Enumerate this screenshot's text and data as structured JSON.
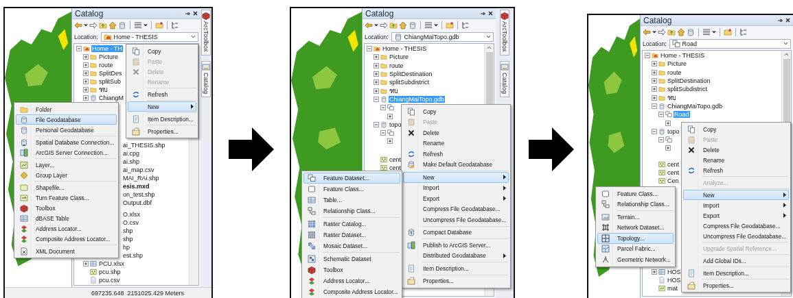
{
  "panels": [
    {
      "catalog": {
        "title": "Catalog",
        "location_label": "Location:",
        "location": {
          "kind": "home",
          "text": "Home - THESIS"
        },
        "tree": [
          {
            "label": "Home - TH",
            "kind": "home",
            "expanded": true,
            "selected": true,
            "children": [
              {
                "label": "Picture",
                "kind": "folder",
                "expanded": false,
                "selected": false
              },
              {
                "label": "route",
                "kind": "folder",
                "expanded": false,
                "selected": false
              },
              {
                "label": "SplitDes",
                "kind": "folder",
                "expanded": false,
                "selected": false
              },
              {
                "label": "splitSub",
                "kind": "folder",
                "expanded": false,
                "selected": false
              },
              {
                "label": "ฑบ",
                "kind": "folder",
                "expanded": false,
                "selected": false
              },
              {
                "label": "ChiangM",
                "kind": "database",
                "expanded": false,
                "selected": false
              },
              {
                "label": "ai_THESIS.shp",
                "kind": "fragment",
                "bold": false,
                "selected": false
              },
              {
                "label": "ai.cpg",
                "kind": "fragment",
                "bold": false,
                "selected": false
              },
              {
                "label": "ai.shp",
                "kind": "fragment",
                "bold": false,
                "selected": false
              },
              {
                "label": "ai_map.csv",
                "kind": "fragment",
                "bold": false,
                "selected": false
              },
              {
                "label": "MAI_RAi.shp",
                "kind": "fragment",
                "bold": false,
                "selected": false
              },
              {
                "label": "esis.mxd",
                "kind": "fragment",
                "bold": true,
                "selected": false
              },
              {
                "label": "on_test.shp",
                "kind": "fragment",
                "bold": false,
                "selected": false
              },
              {
                "label": "Output.dbf",
                "kind": "fragment",
                "bold": false,
                "selected": false
              },
              {
                "label": "O.xlsx",
                "kind": "fragment",
                "bold": false,
                "selected": false
              },
              {
                "label": "O.csv",
                "kind": "fragment",
                "bold": false,
                "selected": false
              },
              {
                "label": "shp",
                "kind": "fragment",
                "bold": false,
                "selected": false
              },
              {
                "label": "shp",
                "kind": "fragment",
                "bold": false,
                "selected": false
              },
              {
                "label": "hp",
                "kind": "fragment",
                "bold": false,
                "selected": false
              },
              {
                "label": "est.shp",
                "kind": "fragment",
                "bold": false,
                "selected": false
              },
              {
                "label": "PCU.xlsx",
                "kind": "table",
                "expanded": false,
                "selected": false
              },
              {
                "label": "pcu.shp",
                "kind": "point",
                "selected": false
              },
              {
                "label": "pcu.csv",
                "kind": "doc",
                "selected": false
              }
            ]
          }
        ]
      },
      "side_tabs": [
        "ArcToolbox",
        "Catalog"
      ],
      "context_menu": [
        {
          "label": "Copy",
          "kind": "copy",
          "disabled": false,
          "selected": false,
          "submenu": false
        },
        {
          "label": "Paste",
          "kind": "paste",
          "disabled": true,
          "selected": false,
          "submenu": false
        },
        {
          "label": "Delete",
          "kind": "delete",
          "disabled": true,
          "selected": false,
          "submenu": false
        },
        {
          "label": "Rename",
          "kind": "plain",
          "disabled": true,
          "selected": false,
          "submenu": false
        },
        {
          "kind": "separator"
        },
        {
          "label": "Refresh",
          "kind": "refresh",
          "disabled": false,
          "selected": false,
          "submenu": false
        },
        {
          "kind": "separator"
        },
        {
          "label": "New",
          "kind": "plain",
          "disabled": false,
          "selected": true,
          "submenu": true
        },
        {
          "kind": "separator"
        },
        {
          "label": "Item Description...",
          "kind": "describe",
          "disabled": false,
          "selected": false,
          "submenu": false
        },
        {
          "kind": "separator"
        },
        {
          "label": "Properties...",
          "kind": "properties",
          "disabled": false,
          "selected": false,
          "submenu": false
        }
      ],
      "submenu": [
        {
          "label": "Folder",
          "kind": "folder",
          "disabled": false,
          "selected": false,
          "submenu": false
        },
        {
          "label": "File Geodatabase",
          "kind": "database",
          "disabled": false,
          "selected": true,
          "submenu": false
        },
        {
          "label": "Personal Geodatabase",
          "kind": "database",
          "disabled": false,
          "selected": false,
          "submenu": false
        },
        {
          "kind": "separator"
        },
        {
          "label": "Spatial Database Connection...",
          "kind": "connection",
          "disabled": false,
          "selected": false,
          "submenu": false
        },
        {
          "label": "ArcGIS Server Connection...",
          "kind": "server",
          "disabled": false,
          "selected": false,
          "submenu": false
        },
        {
          "kind": "separator"
        },
        {
          "label": "Layer...",
          "kind": "layer",
          "disabled": false,
          "selected": false,
          "submenu": false
        },
        {
          "label": "Group Layer",
          "kind": "grouplayer",
          "disabled": false,
          "selected": false,
          "submenu": false
        },
        {
          "kind": "separator"
        },
        {
          "label": "Shapefile...",
          "kind": "shapefile",
          "disabled": false,
          "selected": false,
          "submenu": false
        },
        {
          "label": "Turn Feature Class...",
          "kind": "turnfc",
          "disabled": false,
          "selected": false,
          "submenu": false
        },
        {
          "label": "Toolbox",
          "kind": "toolbox",
          "disabled": false,
          "selected": false,
          "submenu": false
        },
        {
          "label": "dBASE Table",
          "kind": "table",
          "disabled": false,
          "selected": false,
          "submenu": false
        },
        {
          "label": "Address Locator...",
          "kind": "locator",
          "disabled": false,
          "selected": false,
          "submenu": false
        },
        {
          "label": "Composite Address Locator...",
          "kind": "locator",
          "disabled": false,
          "selected": false,
          "submenu": false
        },
        {
          "kind": "separator"
        },
        {
          "label": "XML Document",
          "kind": "xml",
          "disabled": false,
          "selected": false,
          "submenu": false
        }
      ],
      "status": "697235.648  2151025.429 Meters"
    },
    {
      "catalog": {
        "title": "Catalog",
        "location_label": "Location:",
        "location": {
          "kind": "database",
          "text": "ChiangMaiTopo.gdb"
        },
        "tree": [
          {
            "label": "Home - THESIS",
            "kind": "home",
            "expanded": true,
            "selected": false,
            "children": [
              {
                "label": "Picture",
                "kind": "folder",
                "expanded": false,
                "selected": false
              },
              {
                "label": "route",
                "kind": "folder",
                "expanded": false,
                "selected": false
              },
              {
                "label": "SplitDestination",
                "kind": "folder",
                "expanded": false,
                "selected": false
              },
              {
                "label": "splitSubdistrict",
                "kind": "folder",
                "expanded": false,
                "selected": false
              },
              {
                "label": "ฑบ",
                "kind": "folder",
                "expanded": false,
                "selected": false
              },
              {
                "label": "ChiangMaiTopo.gdb",
                "kind": "database",
                "expanded": true,
                "selected": true,
                "children": [
                  {
                    "kind": "dataset",
                    "expanded": true,
                    "children": [
                      {
                        "expanded": false
                      }
                    ]
                  }
                ]
              },
              {
                "label": "topo",
                "kind": "database",
                "expanded": true,
                "selected": false,
                "children": [
                  {
                    "kind": "dataset",
                    "expanded": true,
                    "children": [
                      {
                        "expanded": false
                      }
                    ]
                  }
                ]
              },
              {
                "label": "cent",
                "kind": "point",
                "selected": false
              },
              {
                "label": "cent",
                "kind": "point",
                "selected": false
              }
            ]
          }
        ]
      },
      "side_tabs": [
        "ArcToolbox",
        "Catalog"
      ],
      "context_menu": [
        {
          "label": "Copy",
          "kind": "copy",
          "disabled": false,
          "selected": false,
          "submenu": false
        },
        {
          "label": "Paste",
          "kind": "paste",
          "disabled": true,
          "selected": false,
          "submenu": false
        },
        {
          "label": "Delete",
          "kind": "delete",
          "disabled": false,
          "selected": false,
          "submenu": false
        },
        {
          "label": "Rename",
          "kind": "plain",
          "disabled": false,
          "selected": false,
          "submenu": false
        },
        {
          "label": "Refresh",
          "kind": "refresh",
          "disabled": false,
          "selected": false,
          "submenu": false
        },
        {
          "label": "Make Default Geodatabase",
          "kind": "makedefault",
          "disabled": false,
          "selected": false,
          "submenu": false
        },
        {
          "kind": "separator"
        },
        {
          "label": "New",
          "kind": "plain",
          "disabled": false,
          "selected": true,
          "submenu": true
        },
        {
          "label": "Import",
          "kind": "plain",
          "disabled": false,
          "selected": false,
          "submenu": true
        },
        {
          "label": "Export",
          "kind": "plain",
          "disabled": false,
          "selected": false,
          "submenu": true
        },
        {
          "label": "Compress File Geodatabase...",
          "kind": "plain",
          "disabled": false,
          "selected": false,
          "submenu": false
        },
        {
          "label": "Uncompress File Geodatabase...",
          "kind": "plain",
          "disabled": false,
          "selected": false,
          "submenu": false
        },
        {
          "kind": "separator"
        },
        {
          "label": "Compact Database",
          "kind": "compact",
          "disabled": false,
          "selected": false,
          "submenu": false
        },
        {
          "kind": "separator"
        },
        {
          "label": "Publish to ArcGIS Server...",
          "kind": "publish",
          "disabled": false,
          "selected": false,
          "submenu": false
        },
        {
          "label": "Distributed Geodatabase",
          "kind": "plain",
          "disabled": false,
          "selected": false,
          "submenu": true
        },
        {
          "kind": "separator"
        },
        {
          "label": "Item Description...",
          "kind": "describe",
          "disabled": false,
          "selected": false,
          "submenu": false
        },
        {
          "kind": "separator"
        },
        {
          "label": "Properties...",
          "kind": "properties",
          "disabled": false,
          "selected": false,
          "submenu": false
        }
      ],
      "submenu": [
        {
          "label": "Feature Dataset...",
          "kind": "dataset",
          "disabled": false,
          "selected": true,
          "submenu": false
        },
        {
          "label": "Feature Class...",
          "kind": "featureclass",
          "disabled": false,
          "selected": false,
          "submenu": false
        },
        {
          "label": "Table...",
          "kind": "table",
          "disabled": false,
          "selected": false,
          "submenu": false
        },
        {
          "label": "Relationship Class...",
          "kind": "relationship",
          "disabled": false,
          "selected": false,
          "submenu": false
        },
        {
          "kind": "separator"
        },
        {
          "label": "Raster Catalog...",
          "kind": "rastercatalog",
          "disabled": false,
          "selected": false,
          "submenu": false
        },
        {
          "label": "Raster Dataset...",
          "kind": "rasterdataset",
          "disabled": false,
          "selected": false,
          "submenu": false
        },
        {
          "label": "Mosaic Dataset...",
          "kind": "mosaic",
          "disabled": false,
          "selected": false,
          "submenu": false
        },
        {
          "kind": "separator"
        },
        {
          "label": "Schematic Dataset",
          "kind": "schematic",
          "disabled": false,
          "selected": false,
          "submenu": false
        },
        {
          "label": "Toolbox",
          "kind": "toolbox",
          "disabled": false,
          "selected": false,
          "submenu": false
        },
        {
          "label": "Address Locator...",
          "kind": "locator",
          "disabled": false,
          "selected": false,
          "submenu": false
        },
        {
          "label": "Composite Address Locator...",
          "kind": "locator",
          "disabled": false,
          "selected": false,
          "submenu": false
        }
      ]
    },
    {
      "catalog": {
        "title": "Catalog",
        "location_label": "Location:",
        "location": {
          "kind": "dataset",
          "text": "Road"
        },
        "tree": [
          {
            "label": "Home - THESIS",
            "kind": "home",
            "expanded": true,
            "selected": false,
            "children": [
              {
                "label": "Picture",
                "kind": "folder",
                "expanded": false,
                "selected": false
              },
              {
                "label": "route",
                "kind": "folder",
                "expanded": false,
                "selected": false
              },
              {
                "label": "SplitDestination",
                "kind": "folder",
                "expanded": false,
                "selected": false
              },
              {
                "label": "splitSubdistrict",
                "kind": "folder",
                "expanded": false,
                "selected": false
              },
              {
                "label": "ฑบ",
                "kind": "folder",
                "expanded": false,
                "selected": false
              },
              {
                "label": "ChiangMaiTopo.gdb",
                "kind": "database",
                "expanded": true,
                "selected": false,
                "children": [
                  {
                    "label": "Road",
                    "kind": "dataset",
                    "expanded": true,
                    "selected": true,
                    "children": [
                      {
                        "expanded": false
                      }
                    ]
                  }
                ]
              },
              {
                "label": "topo",
                "kind": "database",
                "expanded": true,
                "selected": false,
                "children": [
                  {
                    "kind": "dataset",
                    "expanded": true,
                    "children": [
                      {
                        "expanded": false
                      }
                    ]
                  }
                ]
              },
              {
                "label": "cent",
                "kind": "point",
                "selected": false
              },
              {
                "label": "cent",
                "kind": "point",
                "selected": false
              },
              {
                "label": "Cen",
                "kind": "point",
                "selected": false
              },
              {
                "label": "HOS",
                "kind": "table",
                "expanded": false,
                "selected": false
              },
              {
                "label": "HOS",
                "kind": "doc",
                "selected": false
              },
              {
                "label": "mat",
                "kind": "layer",
                "selected": false
              }
            ]
          }
        ]
      },
      "context_menu": [
        {
          "label": "Copy",
          "kind": "copy",
          "disabled": false,
          "selected": false,
          "submenu": false
        },
        {
          "label": "Paste",
          "kind": "paste",
          "disabled": true,
          "selected": false,
          "submenu": false
        },
        {
          "label": "Delete",
          "kind": "delete",
          "disabled": false,
          "selected": false,
          "submenu": false
        },
        {
          "label": "Rename",
          "kind": "plain",
          "disabled": false,
          "selected": false,
          "submenu": false
        },
        {
          "label": "Refresh",
          "kind": "refresh",
          "disabled": false,
          "selected": false,
          "submenu": false
        },
        {
          "kind": "separator"
        },
        {
          "label": "Analyze...",
          "kind": "plain",
          "disabled": true,
          "selected": false,
          "submenu": false
        },
        {
          "kind": "separator"
        },
        {
          "label": "New",
          "kind": "plain",
          "disabled": false,
          "selected": true,
          "submenu": true
        },
        {
          "label": "Import",
          "kind": "plain",
          "disabled": false,
          "selected": false,
          "submenu": true
        },
        {
          "label": "Export",
          "kind": "plain",
          "disabled": false,
          "selected": false,
          "submenu": true
        },
        {
          "label": "Compress File Geodatabase...",
          "kind": "plain",
          "disabled": false,
          "selected": false,
          "submenu": false
        },
        {
          "label": "Uncompress File Geodatabase...",
          "kind": "plain",
          "disabled": false,
          "selected": false,
          "submenu": false
        },
        {
          "kind": "separator"
        },
        {
          "label": "Upgrade Spatial Reference...",
          "kind": "plain",
          "disabled": true,
          "selected": false,
          "submenu": false
        },
        {
          "kind": "separator"
        },
        {
          "label": "Add Global IDs...",
          "kind": "plain",
          "disabled": false,
          "selected": false,
          "submenu": false
        },
        {
          "kind": "separator"
        },
        {
          "label": "Item Description...",
          "kind": "describe",
          "disabled": false,
          "selected": false,
          "submenu": false
        },
        {
          "kind": "separator"
        },
        {
          "label": "Properties...",
          "kind": "properties",
          "disabled": false,
          "selected": false,
          "submenu": false
        }
      ],
      "submenu": [
        {
          "label": "Feature Class...",
          "kind": "featureclass",
          "disabled": false,
          "selected": false,
          "submenu": false
        },
        {
          "label": "Relationship Class...",
          "kind": "relationship",
          "disabled": false,
          "selected": false,
          "submenu": false
        },
        {
          "kind": "separator"
        },
        {
          "label": "Terrain...",
          "kind": "terrain",
          "disabled": false,
          "selected": false,
          "submenu": false
        },
        {
          "label": "Network Dataset...",
          "kind": "network",
          "disabled": false,
          "selected": false,
          "submenu": false
        },
        {
          "label": "Topology...",
          "kind": "topology",
          "disabled": false,
          "selected": true,
          "submenu": false
        },
        {
          "label": "Parcel Fabric...",
          "kind": "parcel",
          "disabled": false,
          "selected": false,
          "submenu": false
        },
        {
          "label": "Geometric Network...",
          "kind": "geometric",
          "disabled": false,
          "selected": false,
          "submenu": false
        }
      ]
    }
  ]
}
